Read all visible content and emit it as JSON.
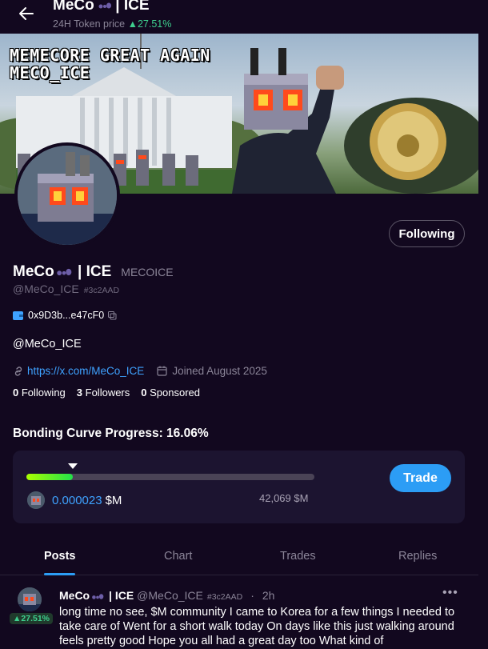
{
  "header": {
    "title": "MeCo​ | ICE",
    "subtitle_label": "24H Token price",
    "change": "▲27.51%"
  },
  "banner": {
    "line1": "MEMECORE GREAT AGAIN",
    "line2": "MECO_ICE"
  },
  "profile": {
    "name": "MeCo | ICE",
    "ticker": "MECOICE",
    "handle": "@MeCo_ICE",
    "tag": "#3c2AAD",
    "wallet": "0x9D3b...e47cF0",
    "bio": "@MeCo_ICE",
    "link": "https://x.com/MeCo_ICE",
    "joined": "Joined August 2025",
    "follow_button": "Following",
    "stats": {
      "following_count": "0",
      "following_label": "Following",
      "followers_count": "3",
      "followers_label": "Followers",
      "sponsored_count": "0",
      "sponsored_label": "Sponsored"
    }
  },
  "bonding": {
    "title": "Bonding Curve Progress: 16.06%",
    "progress": 0.1606,
    "price": "0.000023",
    "price_unit": "$M",
    "mcap": "42,069 $M",
    "trade_button": "Trade"
  },
  "tabs": [
    {
      "label": "Posts",
      "active": true
    },
    {
      "label": "Chart",
      "active": false
    },
    {
      "label": "Trades",
      "active": false
    },
    {
      "label": "Replies",
      "active": false
    }
  ],
  "post": {
    "name": "MeCo | ICE",
    "handle": "@MeCo_ICE",
    "tag": "#3c2AAD",
    "dot": "·",
    "time": "2h",
    "badge": "▲27.51%",
    "more": "•••",
    "text": "long time no see, $M community  I came to Korea for a few things  I needed to take care of Went for a short walk today  On days like this just walking around feels pretty good  Hope you all had a great day too What kind of"
  },
  "colors": {
    "background": "#12081f",
    "accent": "#2c9df5",
    "positive": "#3ecf8e",
    "link": "#3ea2ff"
  }
}
